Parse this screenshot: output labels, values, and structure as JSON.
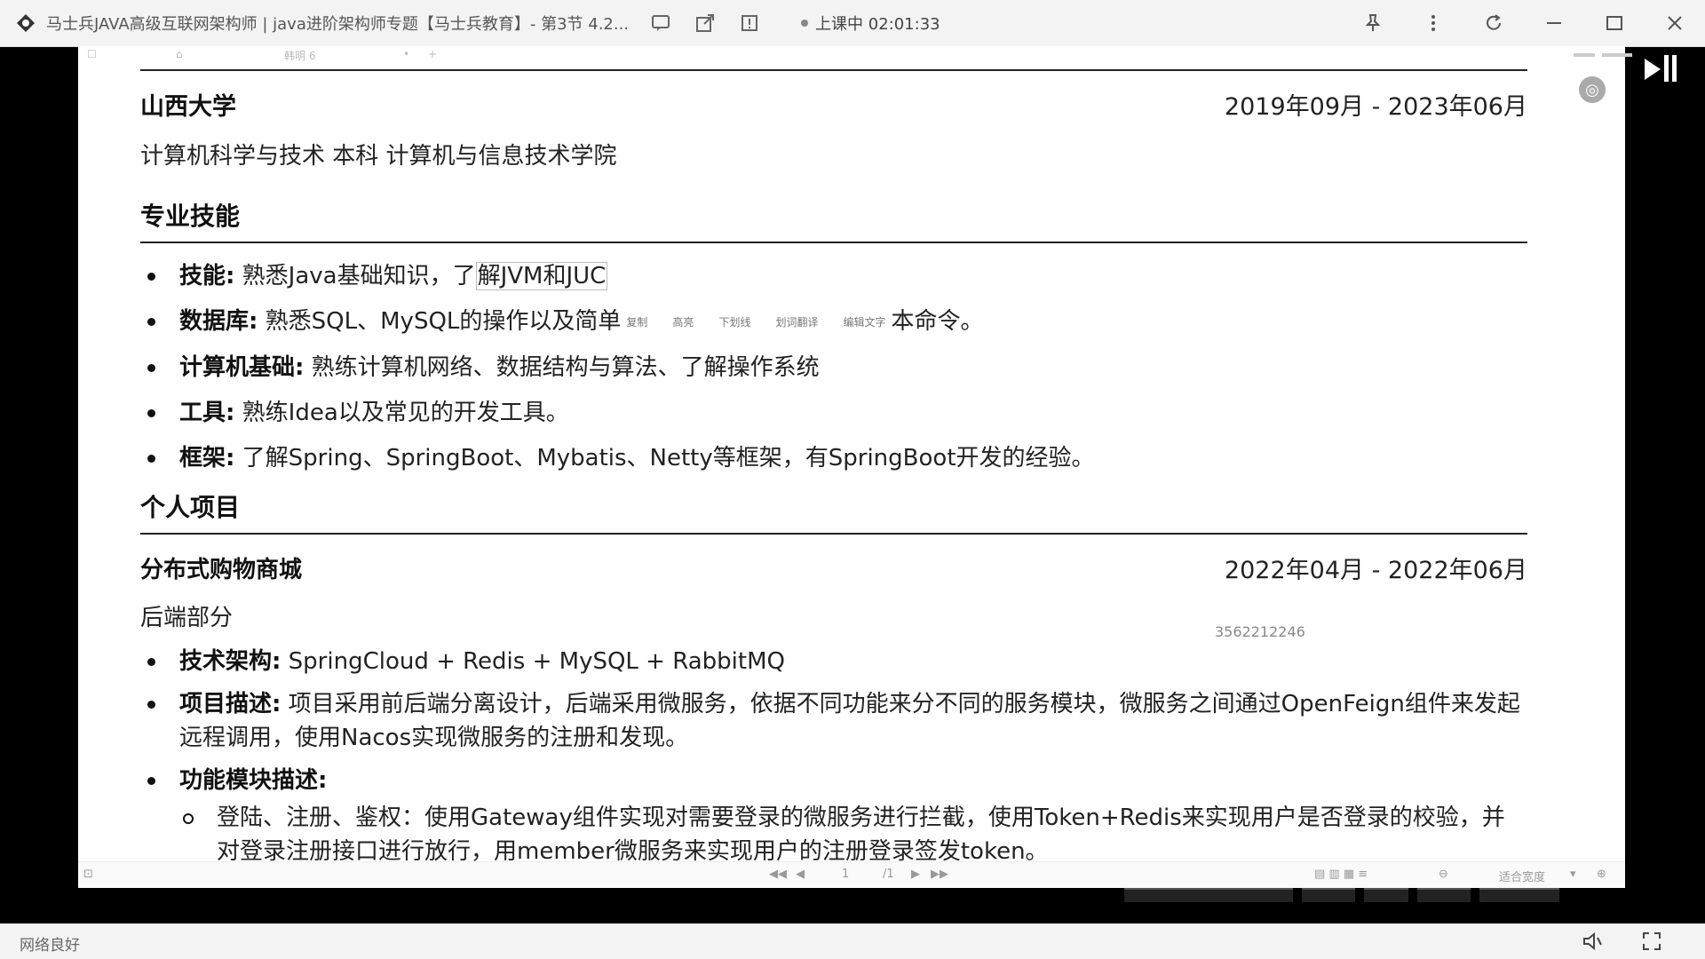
{
  "window": {
    "title": "马士兵JAVA高级互联网架构师 | java进阶架构师专题【马士兵教育】- 第3节 4.2...",
    "live_status": "上课中 02:01:33"
  },
  "viewer": {
    "toolbar_page": "韩明 6",
    "popup_items": [
      "复制",
      "高亮",
      "下划线",
      "划词翻译",
      "编辑文字"
    ],
    "status": {
      "page": "1",
      "total": "/1",
      "zoom": "适合宽度"
    },
    "watermark": "3562212246"
  },
  "education": {
    "school": "山西大学",
    "date_start": "2019年09月",
    "date_end": "- 2023年06月",
    "major": "计算机科学与技术  本科  计算机与信息技术学院"
  },
  "skills": {
    "title": "专业技能",
    "items": [
      {
        "label": "技能:",
        "text_a": " 熟悉Java基础知识，了",
        "text_sel": "解JVM和JUC",
        "text_b": ""
      },
      {
        "label": "数据库:",
        "text_a": " 熟悉SQL、MySQL的操作以及简单",
        "text_sel": "",
        "text_b": "本命令。"
      },
      {
        "label": "计算机基础:",
        "text_a": " 熟练计算机网络、数据结构与算法、了解操作系统",
        "text_sel": "",
        "text_b": ""
      },
      {
        "label": "工具:",
        "text_a": " 熟练Idea以及常见的开发工具。",
        "text_sel": "",
        "text_b": ""
      },
      {
        "label": "框架:",
        "text_a": " 了解Spring、SpringBoot、Mybatis、Netty等框架，有SpringBoot开发的经验。",
        "text_sel": "",
        "text_b": ""
      }
    ]
  },
  "projects": {
    "title": "个人项目",
    "name": "分布式购物商城",
    "date_start": "2022年04月",
    "date_end": "- 2022年06月",
    "part": "后端部分",
    "stack_label": "技术架构:",
    "stack": " SpringCloud + Redis + MySQL + RabbitMQ",
    "desc_label": "项目描述:",
    "desc": " 项目采用前后端分离设计，后端采用微服务，依据不同功能来分不同的服务模块，微服务之间通过OpenFeign组件来发起远程调用，使用Nacos实现微服务的注册和发现。",
    "modules_label": "功能模块描述:",
    "modules": [
      "登陆、注册、鉴权：使用Gateway组件实现对需要登录的微服务进行拦截，使用Token+Redis来实现用户是否登录的校验，并对登录注册接口进行放行，用member微服务来实现用户的注册登录签发token。"
    ]
  },
  "footer": {
    "network": "网络良好"
  }
}
